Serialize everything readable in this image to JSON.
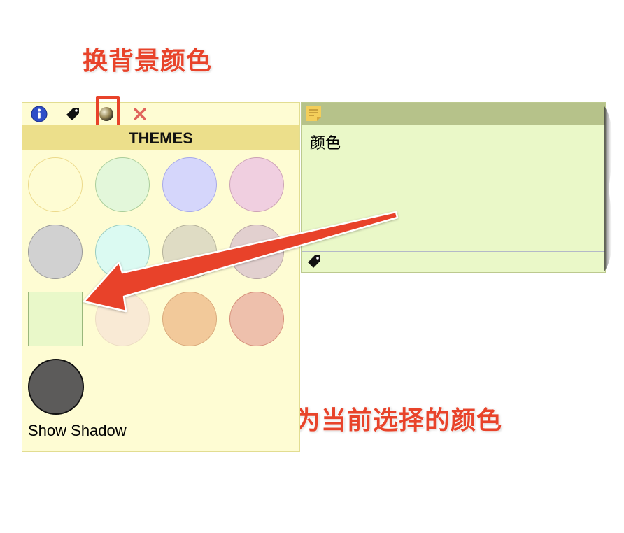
{
  "annotations": {
    "top_label": "换背景颜色",
    "bottom_label": "方形为当前选择的颜色"
  },
  "theme_panel": {
    "toolbar": {
      "icons": [
        "info-icon",
        "tag-icon",
        "theme-icon",
        "close-icon"
      ]
    },
    "header": "THEMES",
    "swatches": [
      {
        "fill": "#fefcd3",
        "border": "#ecd98a"
      },
      {
        "fill": "#e3f7da",
        "border": "#a9cd9a"
      },
      {
        "fill": "#d5d6fb",
        "border": "#a6a8ea"
      },
      {
        "fill": "#f0cfe0",
        "border": "#cba1b5"
      },
      {
        "fill": "#d1d1d1",
        "border": "#9a9a9a"
      },
      {
        "fill": "#dbfaf2",
        "border": "#98ccc1"
      },
      {
        "fill": "#dfdcc4",
        "border": "#b4b19a"
      },
      {
        "fill": "#e2d0cf",
        "border": "#b6a3a2"
      },
      {
        "fill": "#e9f8c9",
        "border": "#9ab77c",
        "selected": true
      },
      {
        "fill": "#f9ead5",
        "border": "#ecdcc3"
      },
      {
        "fill": "#f2c99a",
        "border": "#d8a87a"
      },
      {
        "fill": "#eec0ac",
        "border": "#d58d78"
      }
    ],
    "shadow_toggle": {
      "label": "Show Shadow",
      "fill": "#5c5b5a"
    }
  },
  "note": {
    "text": "颜色",
    "background": "#eaf8c8",
    "header_color": "#b6c28a"
  },
  "colors": {
    "accent_red": "#e8432a",
    "panel_bg": "#fefcd3",
    "header_bg": "#ecdf8b"
  }
}
